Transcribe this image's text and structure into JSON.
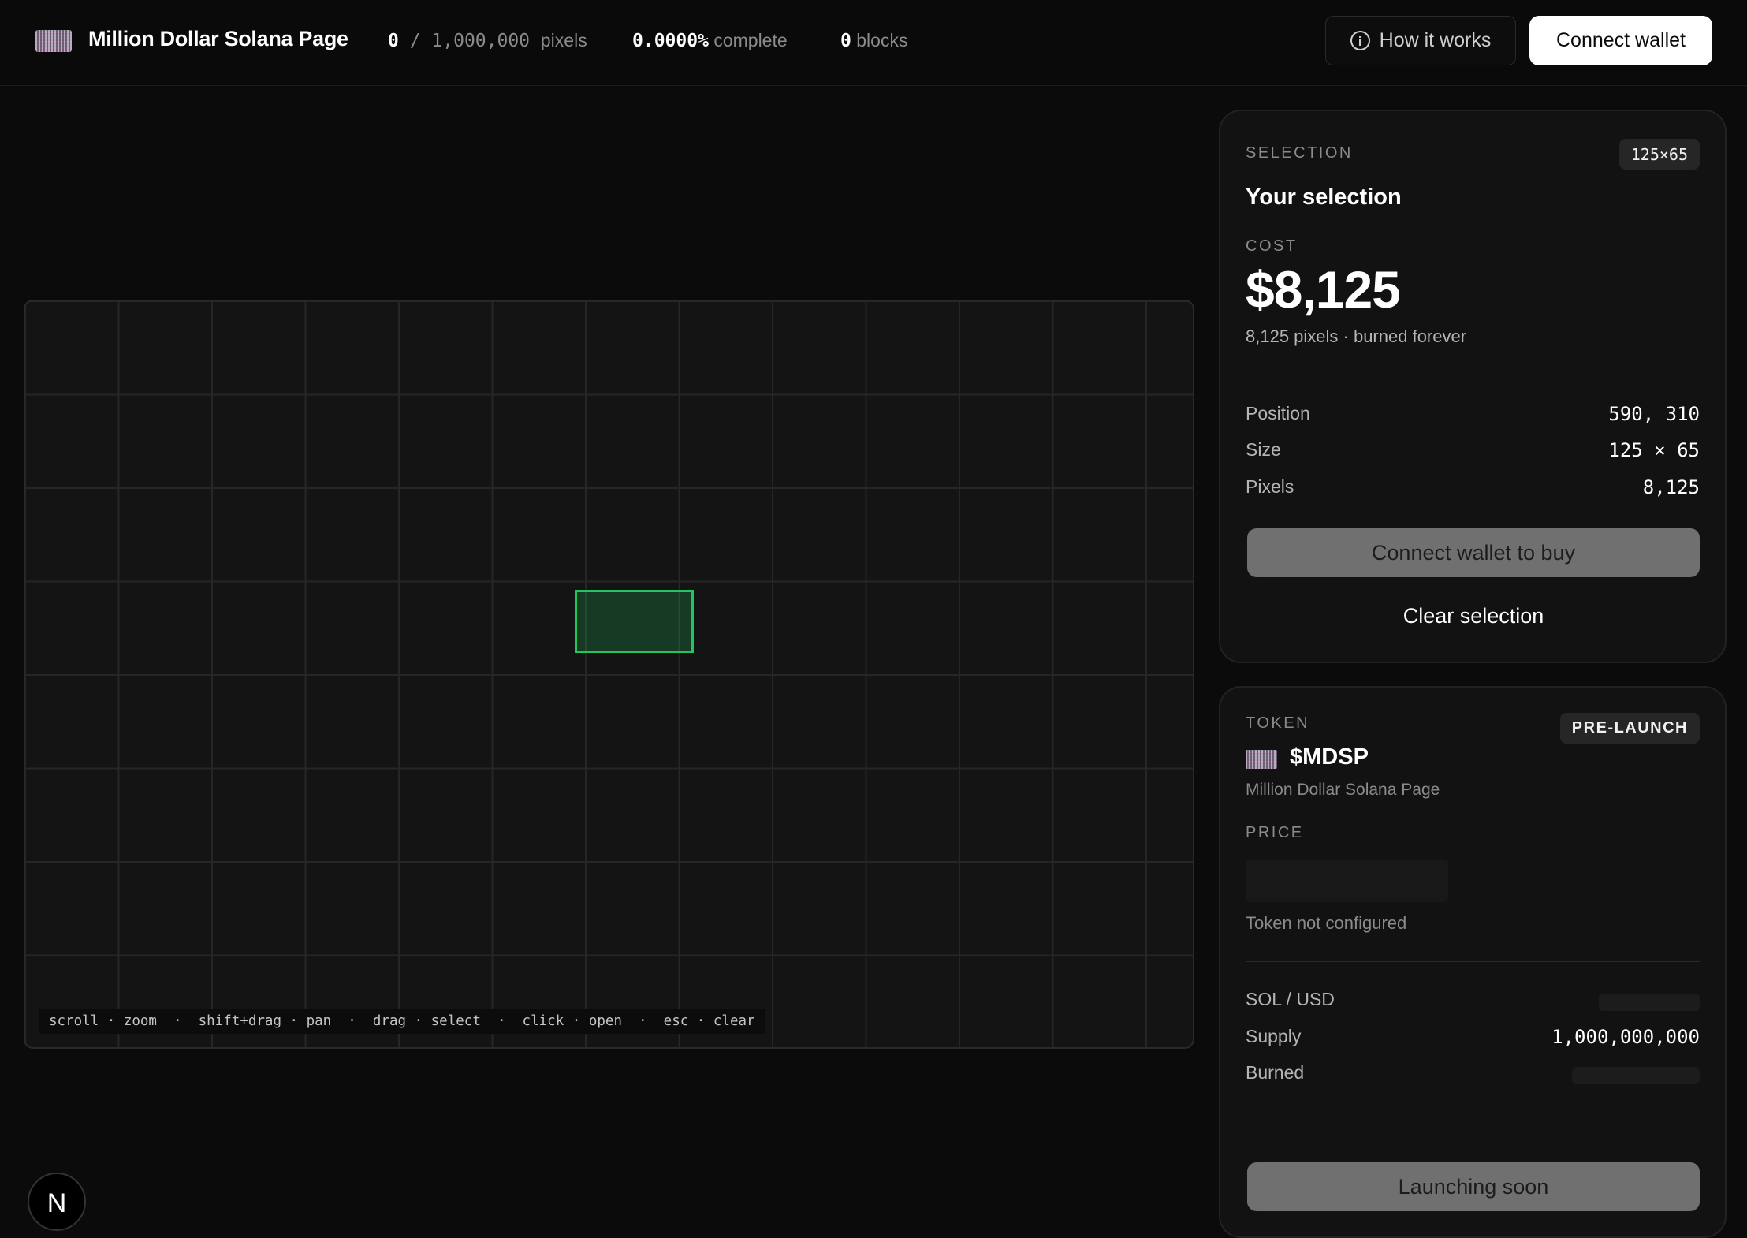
{
  "header": {
    "title": "Million Dollar Solana Page",
    "pixels_filled": "0",
    "pixels_sep": " / ",
    "pixels_total": "1,000,000",
    "pixels_label": "pixels",
    "complete_value": "0.0000%",
    "complete_label": "complete",
    "blocks_value": "0",
    "blocks_label": "blocks",
    "how_label": "How it works",
    "connect_label": "Connect wallet"
  },
  "canvas": {
    "hints": "scroll · zoom  ·  shift+drag · pan  ·  drag · select  ·  click · open  ·  esc · clear",
    "selection_color": "#22c55e"
  },
  "selection": {
    "label": "SELECTION",
    "dims_badge": "125×65",
    "heading": "Your selection",
    "cost_label": "COST",
    "cost_value": "$8,125",
    "cost_sub": "8,125 pixels · burned forever",
    "rows": [
      {
        "label": "Position",
        "value": "590, 310"
      },
      {
        "label": "Size",
        "value": "125 × 65"
      },
      {
        "label": "Pixels",
        "value": "8,125"
      }
    ],
    "buy_label": "Connect wallet to buy",
    "clear_label": "Clear selection"
  },
  "token": {
    "label": "TOKEN",
    "badge": "PRE-LAUNCH",
    "symbol": "$MDSP",
    "name": "Million Dollar Solana Page",
    "price_label": "PRICE",
    "status": "Token not configured",
    "rows": [
      {
        "label": "SOL / USD",
        "value": ""
      },
      {
        "label": "Supply",
        "value": "1,000,000,000"
      },
      {
        "label": "Burned",
        "value": ""
      }
    ],
    "launch_label": "Launching soon"
  },
  "badge": {
    "letter": "N"
  }
}
